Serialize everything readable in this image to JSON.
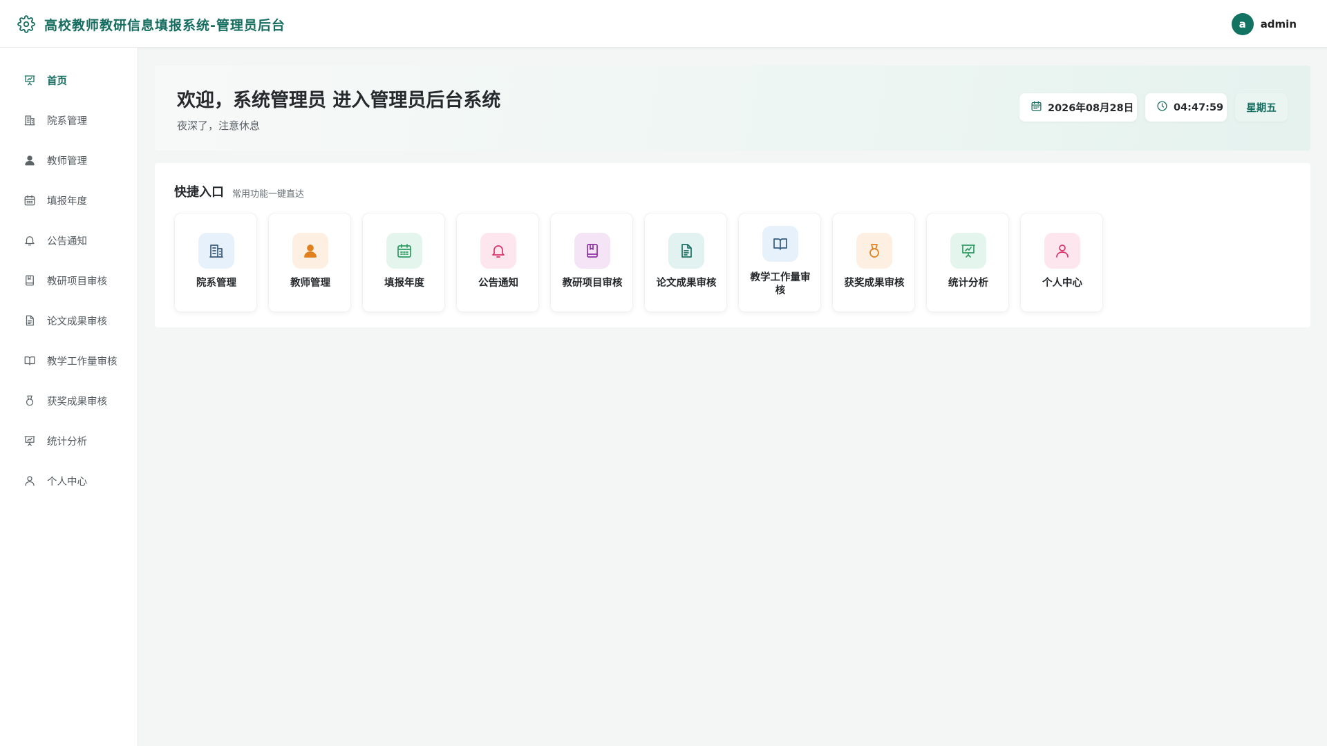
{
  "header": {
    "title": "高校教师教研信息填报系统-管理员后台",
    "logo_icon": "gear-icon",
    "avatar_letter": "a",
    "username": "admin"
  },
  "sidebar": {
    "items": [
      {
        "label": "首页",
        "icon": "presentation-chart-icon",
        "active": true
      },
      {
        "label": "院系管理",
        "icon": "building-icon"
      },
      {
        "label": "教师管理",
        "icon": "user-solid-icon"
      },
      {
        "label": "填报年度",
        "icon": "calendar-icon"
      },
      {
        "label": "公告通知",
        "icon": "bell-icon"
      },
      {
        "label": "教研项目审核",
        "icon": "bookmark-book-icon"
      },
      {
        "label": "论文成果审核",
        "icon": "document-icon"
      },
      {
        "label": "教学工作量审核",
        "icon": "open-book-icon"
      },
      {
        "label": "获奖成果审核",
        "icon": "medal-icon"
      },
      {
        "label": "统计分析",
        "icon": "presentation-chart-icon"
      },
      {
        "label": "个人中心",
        "icon": "user-outline-icon"
      }
    ]
  },
  "banner": {
    "welcome": "欢迎，系统管理员 进入管理员后台系统",
    "subtitle": "夜深了，注意休息",
    "date": "2026年08月28日",
    "time": "04:47:59",
    "weekday": "星期五"
  },
  "quick": {
    "title": "快捷入口",
    "subtitle": "常用功能一键直达",
    "cards": [
      {
        "label": "院系管理",
        "icon": "building-icon",
        "bg": "#e6f1fb",
        "fg": "#3c5a78"
      },
      {
        "label": "教师管理",
        "icon": "user-solid-icon",
        "bg": "#fdf0e2",
        "fg": "#e0801e"
      },
      {
        "label": "填报年度",
        "icon": "calendar-icon",
        "bg": "#e3f5ec",
        "fg": "#2e9a62"
      },
      {
        "label": "公告通知",
        "icon": "bell-icon",
        "bg": "#fde6ee",
        "fg": "#d6336c"
      },
      {
        "label": "教研项目审核",
        "icon": "bookmark-book-icon",
        "bg": "#f4e4f6",
        "fg": "#8e2fa3"
      },
      {
        "label": "论文成果审核",
        "icon": "document-icon",
        "bg": "#e1f2f0",
        "fg": "#1b6f63"
      },
      {
        "label": "教学工作量审核",
        "icon": "open-book-icon",
        "bg": "#e6f1fb",
        "fg": "#345a7d"
      },
      {
        "label": "获奖成果审核",
        "icon": "medal-icon",
        "bg": "#fdf0e2",
        "fg": "#e0801e"
      },
      {
        "label": "统计分析",
        "icon": "presentation-chart-icon",
        "bg": "#e3f5ec",
        "fg": "#2e9a62"
      },
      {
        "label": "个人中心",
        "icon": "user-outline-icon",
        "bg": "#fde6ee",
        "fg": "#d6336c"
      }
    ]
  },
  "colors": {
    "accent": "#156d5f",
    "avatar_bg": "#137363",
    "page_bg": "#f4f6f5"
  }
}
